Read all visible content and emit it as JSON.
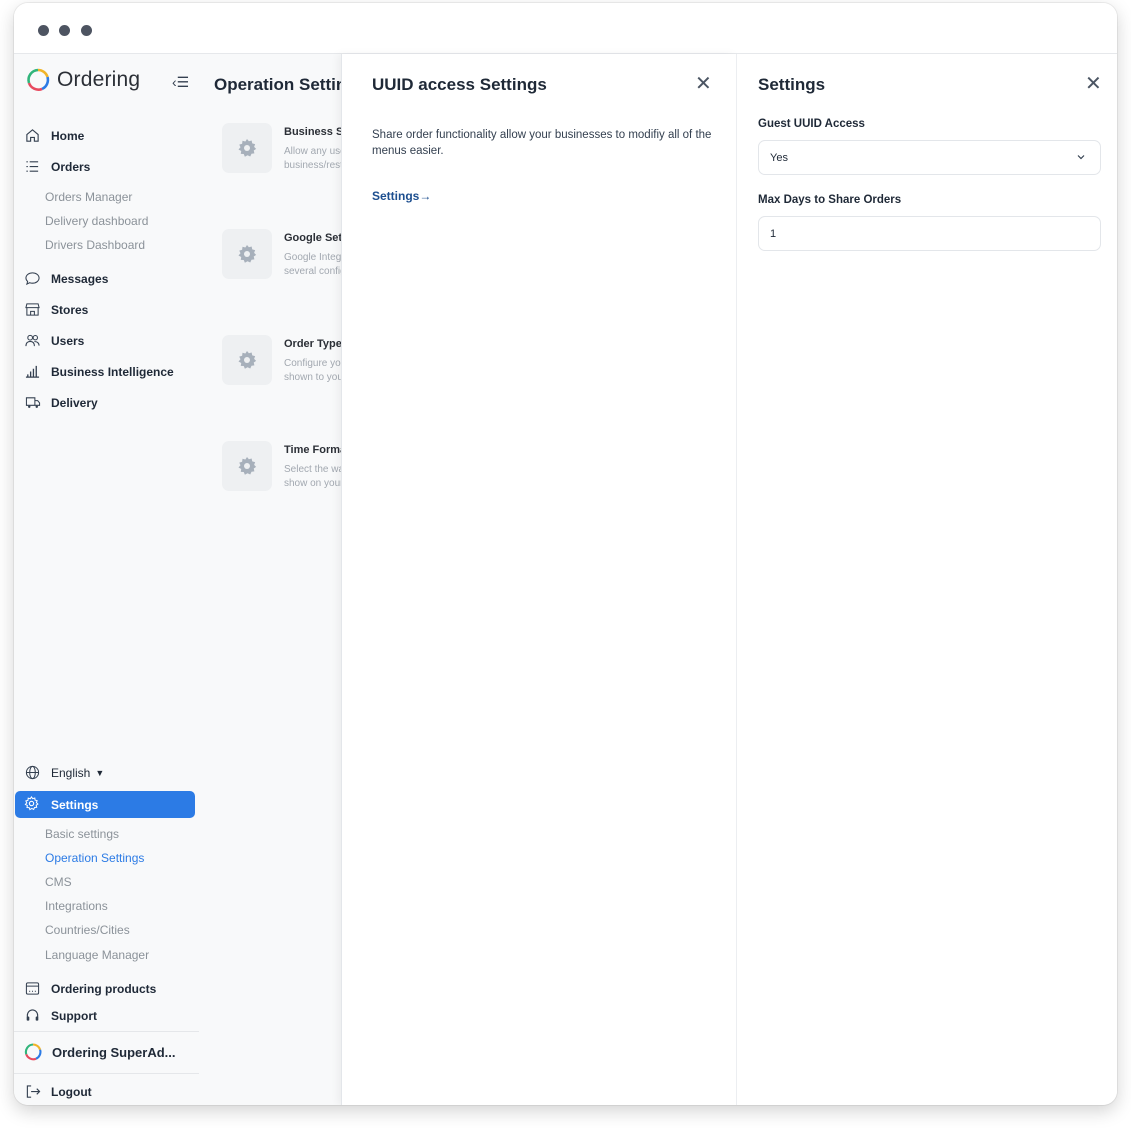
{
  "app": {
    "brand": "Ordering",
    "colors": {
      "accent": "#2c7be5",
      "link": "#1c4e8f",
      "sidebar_bg": "#f8f9fa"
    }
  },
  "sidebar": {
    "nav": [
      {
        "label": "Home",
        "icon": "home-icon"
      },
      {
        "label": "Orders",
        "icon": "list-icon"
      }
    ],
    "orders_sub": [
      "Orders Manager",
      "Delivery dashboard",
      "Drivers Dashboard"
    ],
    "nav2": [
      {
        "label": "Messages",
        "icon": "chat-icon"
      },
      {
        "label": "Stores",
        "icon": "store-icon"
      },
      {
        "label": "Users",
        "icon": "users-icon"
      },
      {
        "label": "Business Intelligence",
        "icon": "bar-chart-icon"
      },
      {
        "label": "Delivery",
        "icon": "truck-icon"
      }
    ],
    "language": "English",
    "settings_label": "Settings",
    "settings_sub": [
      "Basic settings",
      "Operation Settings",
      "CMS",
      "Integrations",
      "Countries/Cities",
      "Language Manager"
    ],
    "settings_active_sub": "Operation Settings",
    "ordering_products": "Ordering products",
    "support": "Support",
    "account_name": "Ordering SuperAd...",
    "logout": "Logout"
  },
  "operation": {
    "title": "Operation Settings",
    "items": [
      {
        "title": "Business Settings",
        "desc1": "Allow any user",
        "desc2": "business/restaurant"
      },
      {
        "title": "Google Settings",
        "desc1": "Google Integration",
        "desc2": "several configurations"
      },
      {
        "title": "Order Type",
        "desc1": "Configure your",
        "desc2": "shown to your"
      },
      {
        "title": "Time Format",
        "desc1": "Select the way",
        "desc2": "show on your"
      }
    ]
  },
  "uuid_panel": {
    "title": "UUID access Settings",
    "description": "Share order functionality allow your businesses to modifiy all of the menus easier.",
    "link": "Settings→"
  },
  "settings_panel": {
    "title": "Settings",
    "guest_label": "Guest UUID Access",
    "guest_value": "Yes",
    "max_days_label": "Max Days to Share Orders",
    "max_days_value": "1"
  }
}
